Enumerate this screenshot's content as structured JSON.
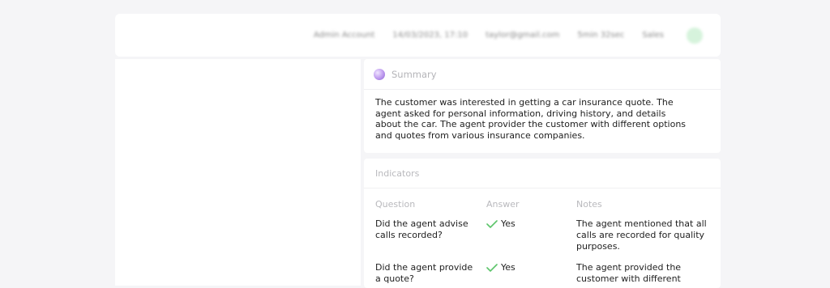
{
  "topbar": {
    "account": "Admin Account",
    "datetime": "14/03/2023, 17:10",
    "email": "taylor@gmail.com",
    "duration": "5min 32sec",
    "department": "Sales"
  },
  "summary": {
    "title": "Summary",
    "text": "The customer was interested in getting a car insurance quote. The agent asked for personal information, driving history, and details about the car. The agent provider the customer with different options and quotes from various insurance companies."
  },
  "indicators": {
    "title": "Indicators",
    "columns": {
      "question": "Question",
      "answer": "Answer",
      "notes": "Notes"
    },
    "rows": [
      {
        "question": "Did the agent advise calls recorded?",
        "answer": "Yes",
        "notes": "The agent mentioned that all calls are recorded for quality purposes."
      },
      {
        "question": "Did the agent provide a quote?",
        "answer": "Yes",
        "notes": "The agent provided the customer with different"
      }
    ]
  },
  "colors": {
    "check": "#5cc46a",
    "status_dot": "#d6f3dc",
    "orb": "#b28ae8"
  }
}
